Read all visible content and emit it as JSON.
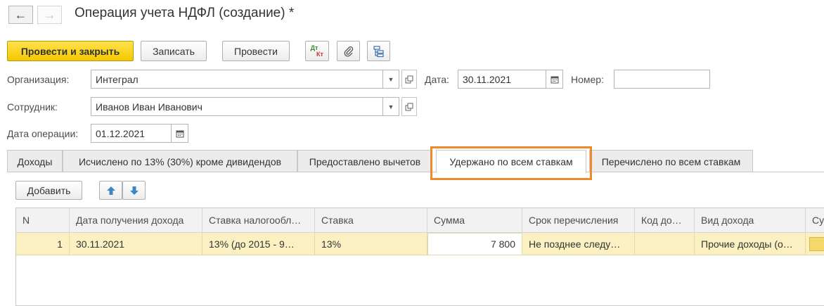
{
  "window": {
    "title": "Операция учета НДФЛ (создание) *",
    "back_icon": "arrow-left-icon",
    "forward_icon": "arrow-right-icon"
  },
  "toolbar": {
    "post_close_label": "Провести и закрыть",
    "save_label": "Записать",
    "post_label": "Провести",
    "dtkt_top": "Дт",
    "dtkt_bottom": "Кт",
    "attach_icon": "paperclip-icon",
    "structure_icon": "structure-icon"
  },
  "form": {
    "org_label": "Организация:",
    "org_value": "Интеграл",
    "date_label": "Дата:",
    "date_value": "30.11.2021",
    "number_label": "Номер:",
    "number_value": "",
    "employee_label": "Сотрудник:",
    "employee_value": "Иванов Иван Иванович",
    "op_date_label": "Дата операции:",
    "op_date_value": "01.12.2021"
  },
  "tabs": [
    {
      "label": "Доходы"
    },
    {
      "label": "Исчислено по 13% (30%) кроме дивидендов"
    },
    {
      "label": "Предоставлено вычетов"
    },
    {
      "label": "Удержано по всем ставкам",
      "active": true
    },
    {
      "label": "Перечислено по всем ставкам"
    }
  ],
  "table_toolbar": {
    "add_label": "Добавить",
    "move_up_icon": "arrow-up-icon",
    "move_down_icon": "arrow-down-icon"
  },
  "table": {
    "columns": [
      "N",
      "Дата получения дохода",
      "Ставка налогообл…",
      "Ставка",
      "Сумма",
      "Срок перечисления",
      "Код до…",
      "Вид дохода",
      "Су"
    ],
    "rows": [
      [
        "1",
        "30.11.2021",
        "13% (до 2015 - 9…",
        "13%",
        "7 800",
        "Не позднее следу…",
        "",
        "Прочие доходы (о…",
        ""
      ]
    ]
  },
  "colors": {
    "primary_button": "#f5c800",
    "selected_row": "#fbf0c2",
    "highlight_border": "#ee8a2e",
    "arrow_blue": "#3d86c6"
  }
}
